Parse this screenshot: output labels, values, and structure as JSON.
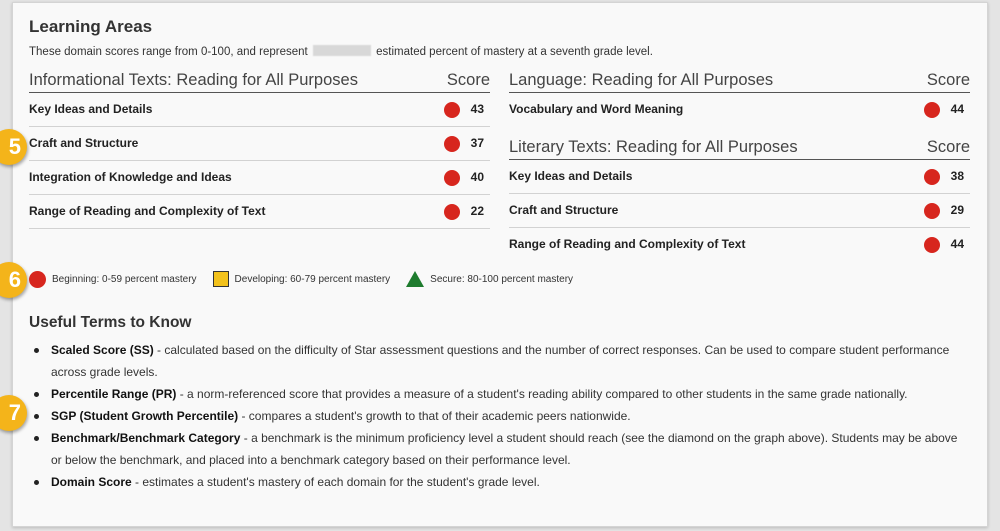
{
  "learning_areas": {
    "title": "Learning Areas",
    "intro_before": "These domain scores range from 0-100, and represent",
    "intro_after": "estimated percent of mastery at a seventh grade level."
  },
  "tables": {
    "informational": {
      "title": "Informational Texts: Reading for All Purposes",
      "score_header": "Score",
      "rows": [
        {
          "label": "Key Ideas and Details",
          "score": "43"
        },
        {
          "label": "Craft and Structure",
          "score": "37"
        },
        {
          "label": "Integration of Knowledge and Ideas",
          "score": "40"
        },
        {
          "label": "Range of Reading and Complexity of Text",
          "score": "22"
        }
      ]
    },
    "language": {
      "title": "Language: Reading for All Purposes",
      "score_header": "Score",
      "rows": [
        {
          "label": "Vocabulary and Word Meaning",
          "score": "44"
        }
      ]
    },
    "literary": {
      "title": "Literary Texts: Reading for All Purposes",
      "score_header": "Score",
      "rows": [
        {
          "label": "Key Ideas and Details",
          "score": "38"
        },
        {
          "label": "Craft and Structure",
          "score": "29"
        },
        {
          "label": "Range of Reading and Complexity of Text",
          "score": "44"
        }
      ]
    }
  },
  "legend": {
    "beginning": "Beginning: 0-59 percent mastery",
    "developing": "Developing: 60-79 percent mastery",
    "secure": "Secure: 80-100 percent mastery"
  },
  "callouts": [
    "5",
    "6",
    "7"
  ],
  "terms": {
    "title": "Useful Terms to Know",
    "items": [
      {
        "term": "Scaled Score (SS)",
        "desc": " - calculated based on the difficulty of Star assessment questions and the number of correct responses. Can be used to compare student performance across grade levels."
      },
      {
        "term": "Percentile Range (PR)",
        "desc": " - a norm-referenced score that provides a measure of a student's reading ability compared to other students in the same grade nationally."
      },
      {
        "term": "SGP (Student Growth Percentile)",
        "desc": " - compares a student's growth to that of their academic peers nationwide."
      },
      {
        "term": "Benchmark/Benchmark Category",
        "desc": " - a benchmark is the minimum proficiency level a student should reach (see the diamond on the graph above). Students may be above or below the benchmark, and placed into a benchmark category based on their performance level."
      },
      {
        "term": "Domain Score",
        "desc": " - estimates a student's mastery of each domain for the student's grade level."
      }
    ]
  },
  "colors": {
    "beginning": "#d7261e",
    "developing": "#f3c21b",
    "secure": "#1e7b2e",
    "callout": "#f4b41a"
  }
}
